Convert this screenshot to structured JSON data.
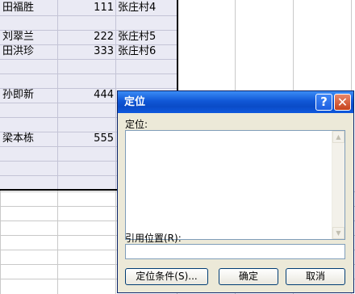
{
  "sheet": {
    "rows": [
      {
        "name": "田福胜",
        "num": "111",
        "addr": "张庄村4"
      },
      {
        "name": "刘翠兰",
        "num": "222",
        "addr": "张庄村5"
      },
      {
        "name": "田洪珍",
        "num": "333",
        "addr": "张庄村6"
      },
      {
        "name": "孙即新",
        "num": "444",
        "addr": ""
      },
      {
        "name": "梁本栋",
        "num": "555",
        "addr": ""
      }
    ]
  },
  "dialog": {
    "title": "定位",
    "help_glyph": "?",
    "close_glyph": "✕",
    "goto_label": "定位:",
    "reference_label": "引用位置(R):",
    "reference_value": "",
    "buttons": {
      "special": "定位条件(S)...",
      "ok": "确定",
      "cancel": "取消"
    }
  },
  "colors": {
    "selection_fill": "#eaeaf4",
    "titlebar": "#0a4bc7",
    "dialog_face": "#ece9d8"
  }
}
